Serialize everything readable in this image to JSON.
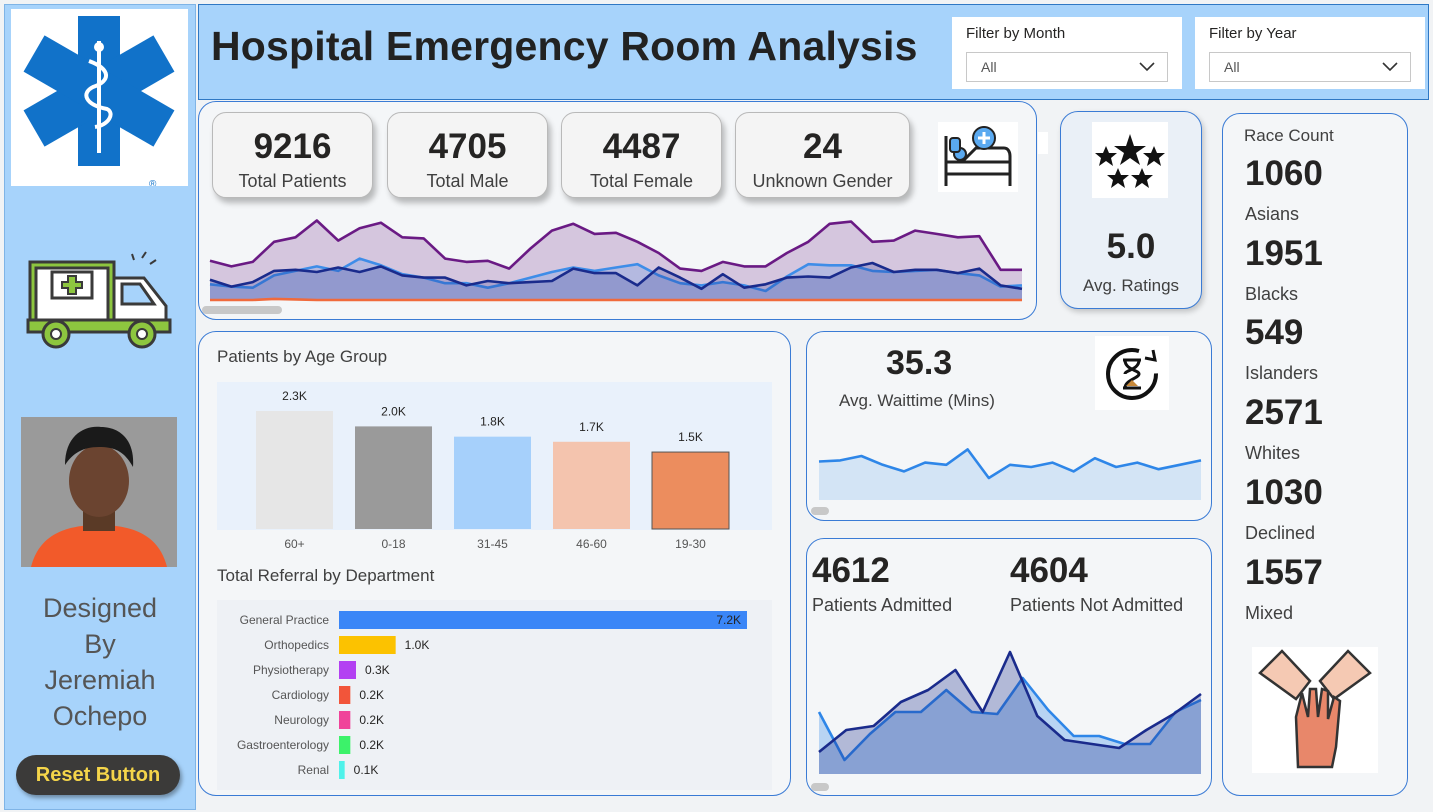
{
  "header": {
    "title": "Hospital Emergency Room Analysis",
    "filter_month": {
      "label": "Filter by Month",
      "value": "All"
    },
    "filter_year": {
      "label": "Filter by Year",
      "value": "All"
    }
  },
  "sidebar": {
    "credit_line1": "Designed",
    "credit_line2": "By",
    "credit_line3": "Jeremiah",
    "credit_line4": "Ochepo",
    "reset_label": "Reset Button"
  },
  "kpis": [
    {
      "value": "9216",
      "label": "Total Patients"
    },
    {
      "value": "4705",
      "label": "Total Male"
    },
    {
      "value": "4487",
      "label": "Total Female"
    },
    {
      "value": "24",
      "label": "Unknown Gender"
    }
  ],
  "ratings": {
    "value": "5.0",
    "label": "Avg. Ratings"
  },
  "waittime": {
    "value": "35.3",
    "label": "Avg. Waittime (Mins)"
  },
  "admission": {
    "admitted_value": "4612",
    "admitted_label": "Patients Admitted",
    "not_admitted_value": "4604",
    "not_admitted_label": "Patients Not Admitted"
  },
  "race": {
    "title": "Race Count",
    "items": [
      {
        "value": "1060",
        "label": "Asians"
      },
      {
        "value": "1951",
        "label": "Blacks"
      },
      {
        "value": "549",
        "label": "Islanders"
      },
      {
        "value": "2571",
        "label": "Whites"
      },
      {
        "value": "1030",
        "label": "Declined"
      },
      {
        "value": "1557",
        "label": "Mixed"
      }
    ]
  },
  "colors": {
    "accent_blue": "#2f78c4",
    "sidebar_bg": "#a7d3fb",
    "bar_60plus": "#e6e6e6",
    "bar_0_18": "#9a9a9a",
    "bar_31_45": "#a6d0fb",
    "bar_46_60": "#f4c4ae",
    "bar_19_30": "#ec8d5e"
  },
  "chart_data": [
    {
      "id": "age_group",
      "type": "bar",
      "title": "Patients by Age Group",
      "categories": [
        "60+",
        "0-18",
        "31-45",
        "46-60",
        "19-30"
      ],
      "values": [
        2300,
        2000,
        1800,
        1700,
        1500
      ],
      "labels": [
        "2.3K",
        "2.0K",
        "1.8K",
        "1.7K",
        "1.5K"
      ],
      "colors": [
        "#e6e6e6",
        "#9a9a9a",
        "#a6d0fb",
        "#f4c4ae",
        "#ec8d5e"
      ],
      "ylim": [
        0,
        2300
      ]
    },
    {
      "id": "referral",
      "type": "bar",
      "orientation": "horizontal",
      "title": "Total Referral by Department",
      "categories": [
        "General Practice",
        "Orthopedics",
        "Physiotherapy",
        "Cardiology",
        "Neurology",
        "Gastroenterology",
        "Renal"
      ],
      "values": [
        7200,
        1000,
        300,
        200,
        200,
        200,
        100
      ],
      "labels": [
        "7.2K",
        "1.0K",
        "0.3K",
        "0.2K",
        "0.2K",
        "0.2K",
        "0.1K"
      ],
      "colors": [
        "#3a86f7",
        "#fcc200",
        "#b340f2",
        "#f2553a",
        "#f0439a",
        "#3cf26a",
        "#4ff2ea"
      ],
      "xlim": [
        0,
        7200
      ]
    },
    {
      "id": "patients_trend",
      "type": "area",
      "ylim": [
        0,
        150
      ],
      "series": [
        {
          "color": "#6a1a84",
          "values": [
            70,
            60,
            68,
            104,
            112,
            142,
            106,
            128,
            138,
            112,
            110,
            74,
            68,
            70,
            56,
            92,
            124,
            136,
            118,
            120,
            104,
            84,
            56,
            52,
            68,
            60,
            60,
            84,
            104,
            136,
            140,
            104,
            106,
            124,
            118,
            112,
            114,
            54,
            54
          ]
        },
        {
          "color": "#3e8de8",
          "values": [
            28,
            24,
            22,
            44,
            52,
            60,
            52,
            74,
            62,
            46,
            40,
            30,
            30,
            22,
            30,
            40,
            50,
            58,
            52,
            58,
            64,
            44,
            30,
            26,
            32,
            26,
            16,
            42,
            64,
            62,
            62,
            52,
            50,
            52,
            54,
            48,
            44,
            24,
            26
          ]
        },
        {
          "color": "#1a2b8c",
          "values": [
            36,
            24,
            32,
            52,
            54,
            50,
            58,
            50,
            60,
            44,
            40,
            40,
            26,
            34,
            30,
            32,
            34,
            56,
            48,
            48,
            26,
            58,
            40,
            20,
            46,
            22,
            28,
            40,
            42,
            40,
            58,
            66,
            50,
            54,
            54,
            48,
            56,
            26,
            20
          ]
        },
        {
          "color": "#f06a3c",
          "values": [
            0,
            0,
            0,
            2,
            1,
            0,
            0,
            0,
            0,
            0,
            0,
            0,
            0,
            0,
            0,
            0,
            0,
            0,
            0,
            0,
            0,
            0,
            0,
            0,
            0,
            0,
            0,
            0,
            0,
            0,
            0,
            0,
            0,
            0,
            0,
            0,
            0,
            0,
            0
          ]
        }
      ]
    },
    {
      "id": "waittime_trend",
      "type": "area",
      "ylim": [
        0,
        60
      ],
      "series": [
        {
          "color": "#2e86e8",
          "values": [
            35,
            36,
            40,
            32,
            26,
            34,
            32,
            46,
            20,
            32,
            30,
            34,
            26,
            38,
            30,
            34,
            28,
            32,
            36
          ]
        }
      ]
    },
    {
      "id": "admission_trend",
      "type": "area",
      "ylim": [
        0,
        130
      ],
      "series": [
        {
          "color": "#2e86e8",
          "values": [
            62,
            14,
            40,
            62,
            62,
            84,
            62,
            60,
            96,
            64,
            38,
            38,
            30,
            30,
            62,
            74
          ]
        },
        {
          "color": "#1a2b8c",
          "values": [
            22,
            44,
            48,
            72,
            84,
            104,
            62,
            122,
            58,
            34,
            30,
            26,
            44,
            60,
            80
          ]
        }
      ]
    }
  ]
}
